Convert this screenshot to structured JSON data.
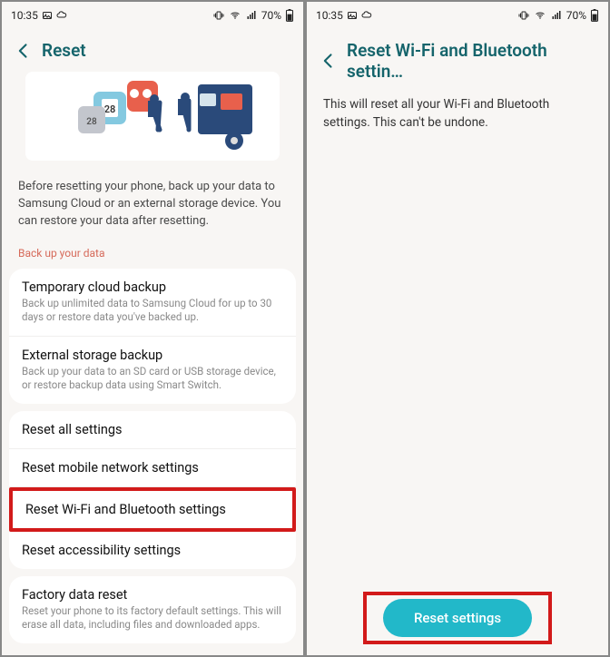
{
  "status": {
    "time": "10:35",
    "battery": "70%"
  },
  "left": {
    "title": "Reset",
    "info": "Before resetting your phone, back up your data to Samsung Cloud or an external storage device. You can restore your data after resetting.",
    "section_label": "Back up your data",
    "backup_items": [
      {
        "title": "Temporary cloud backup",
        "desc": "Back up unlimited data to Samsung Cloud for up to 30 days or restore data you've backed up."
      },
      {
        "title": "External storage backup",
        "desc": "Back up your data to an SD card or USB storage device, or restore backup data using Smart Switch."
      }
    ],
    "reset_items": [
      {
        "title": "Reset all settings",
        "highlight": false
      },
      {
        "title": "Reset mobile network settings",
        "highlight": false
      },
      {
        "title": "Reset Wi-Fi and Bluetooth settings",
        "highlight": true
      },
      {
        "title": "Reset accessibility settings",
        "highlight": false
      }
    ],
    "factory": {
      "title": "Factory data reset",
      "desc": "Reset your phone to its factory default settings. This will erase all data, including files and downloaded apps."
    }
  },
  "right": {
    "title": "Reset Wi-Fi and Bluetooth settin…",
    "body": "This will reset all your Wi-Fi and Bluetooth settings. This can't be undone.",
    "button": "Reset settings"
  }
}
